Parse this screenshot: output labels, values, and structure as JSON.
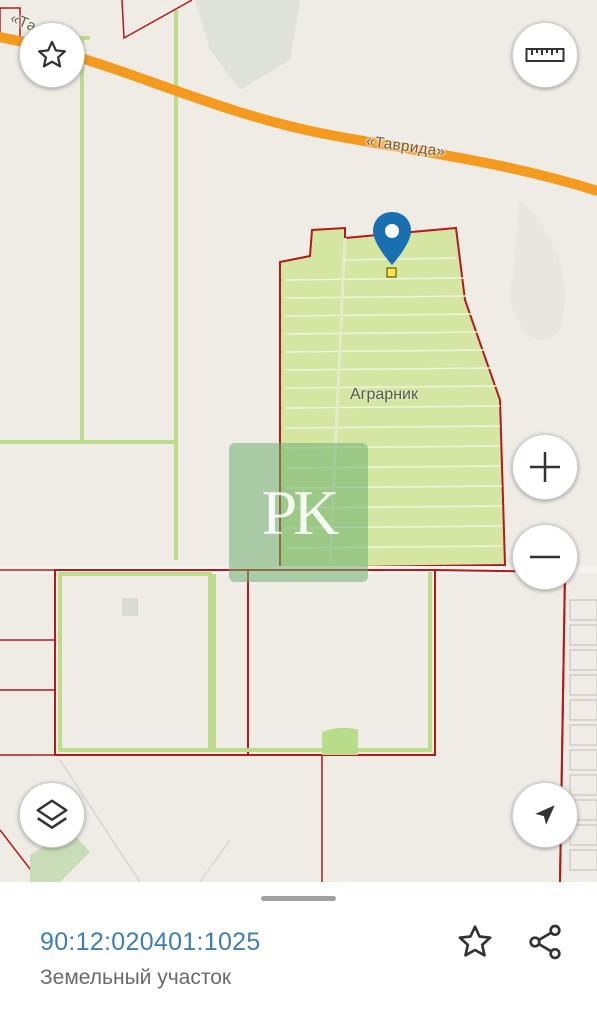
{
  "map": {
    "road_name_left": "«Таврида»",
    "road_name_right": "«Таврида»",
    "place_name": "Аграрник",
    "watermark": "PK",
    "colors": {
      "road": "#f39a1f",
      "parcel_border": "#b31a1a",
      "farmland": "#d4e6a2",
      "field_strip": "#bcdc8c",
      "background": "#efece6",
      "pin": "#1a6fb0"
    }
  },
  "controls": {
    "favorite": "star-icon",
    "ruler": "ruler-icon",
    "zoom_in": "plus-icon",
    "zoom_out": "minus-icon",
    "layers": "layers-icon",
    "locate": "navigation-arrow-icon"
  },
  "sheet": {
    "cadastral_number": "90:12:020401:1025",
    "object_type": "Земельный участок",
    "accent": "#3d7fb0"
  }
}
